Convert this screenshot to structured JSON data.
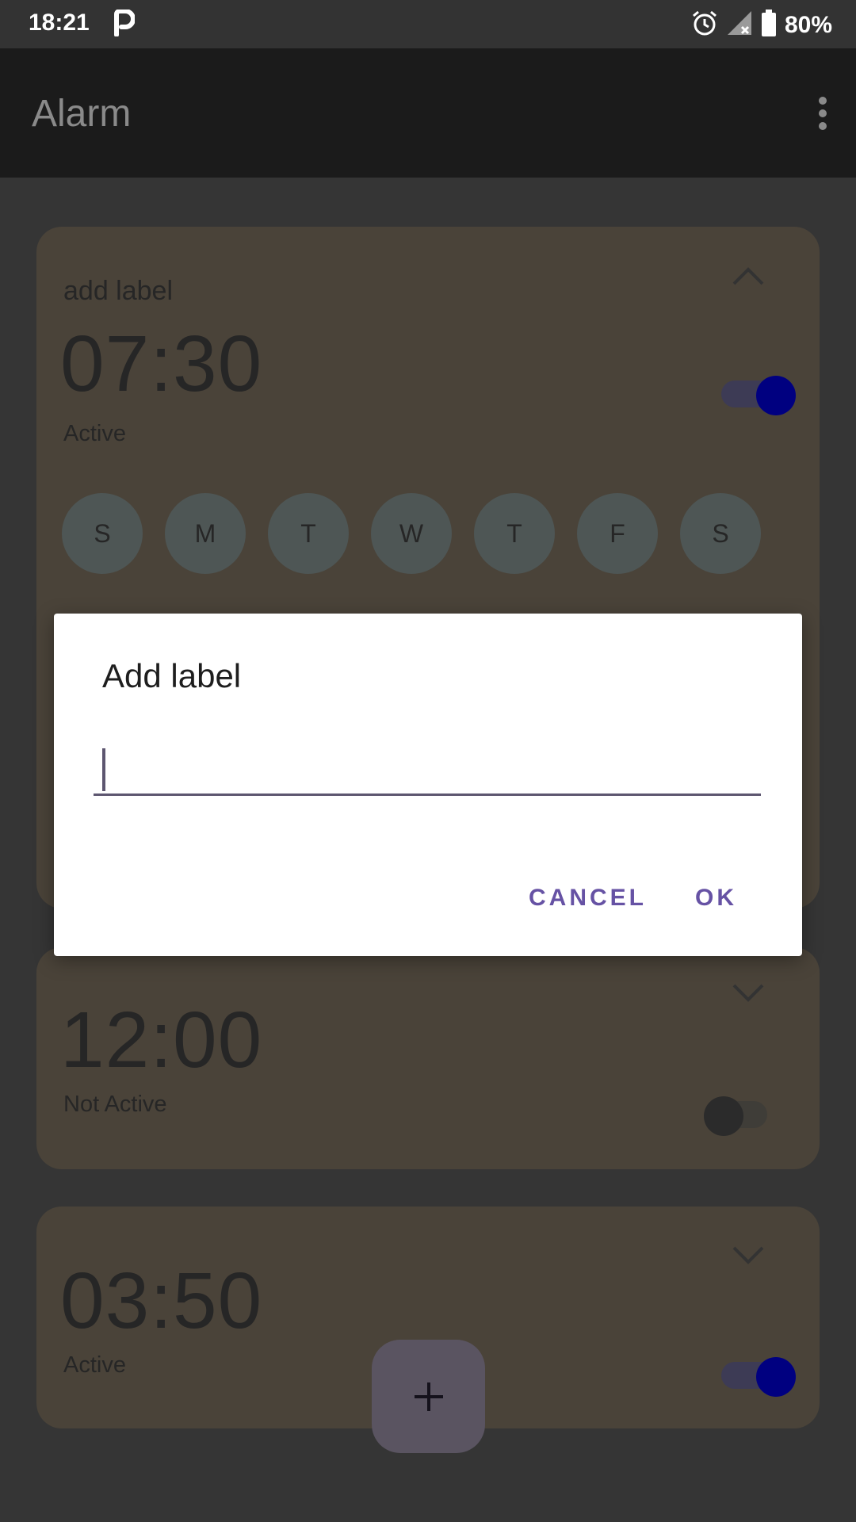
{
  "status_bar": {
    "time": "18:21",
    "battery": "80%",
    "icons": [
      "parking-app-icon",
      "alarm-clock-icon",
      "signal-off-icon",
      "battery-icon"
    ]
  },
  "app_bar": {
    "title": "Alarm",
    "overflow_icon": "more-vert-icon"
  },
  "alarms": [
    {
      "label": "add label",
      "time": "07:30",
      "status": "Active",
      "enabled": true,
      "expanded": true,
      "days": [
        "S",
        "M",
        "T",
        "W",
        "T",
        "F",
        "S"
      ]
    },
    {
      "time": "12:00",
      "status": "Not Active",
      "enabled": false,
      "expanded": false
    },
    {
      "time": "03:50",
      "status": "Active",
      "enabled": true,
      "expanded": false
    }
  ],
  "fab": {
    "icon": "plus-icon"
  },
  "dialog": {
    "title": "Add label",
    "input_value": "",
    "cancel_label": "CANCEL",
    "ok_label": "OK"
  },
  "colors": {
    "accent": "#6652a4",
    "switch_on_thumb": "#000080",
    "card_background": "#4a4339"
  }
}
